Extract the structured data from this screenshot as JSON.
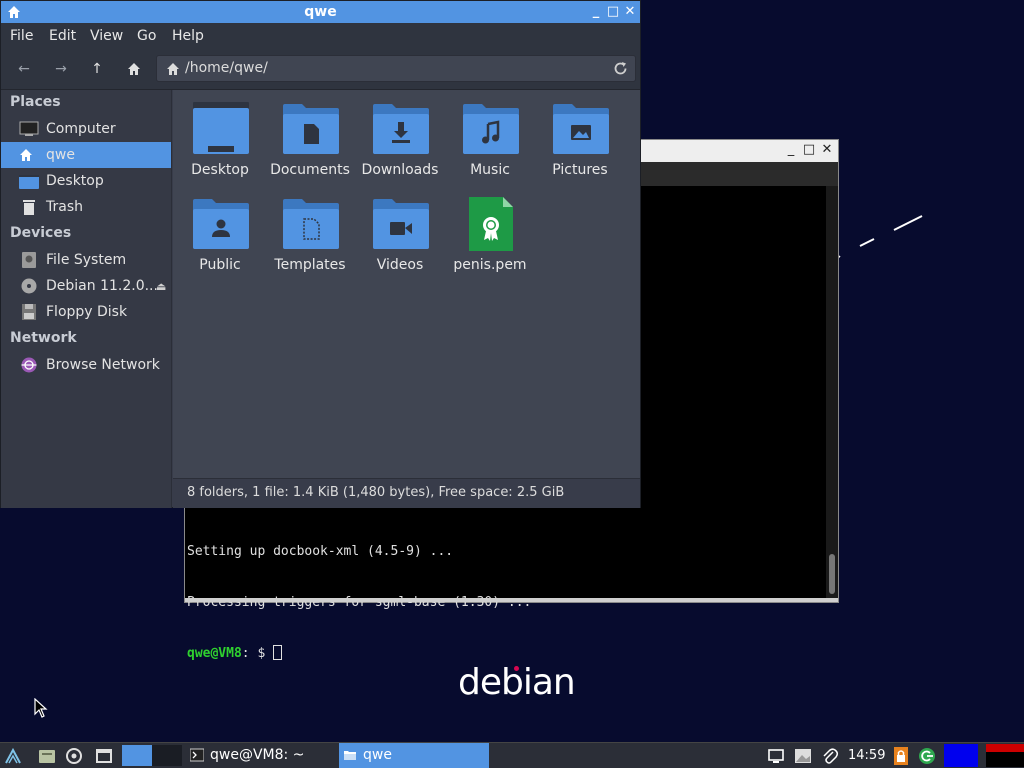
{
  "desktop": {
    "logo_text": "debian"
  },
  "terminal": {
    "lines": [
      "Setting up docbook-xml (4.5-9) ...",
      "Processing triggers for sgml-base (1.30) ..."
    ],
    "prompt_user": "qwe@VM8",
    "prompt_path": ": $ "
  },
  "file_manager": {
    "title": "qwe",
    "menu": [
      "File",
      "Edit",
      "View",
      "Go",
      "Help"
    ],
    "location": "/home/qwe/",
    "sidebar": {
      "places_header": "Places",
      "places": [
        "Computer",
        "qwe",
        "Desktop",
        "Trash"
      ],
      "devices_header": "Devices",
      "devices": [
        "File System",
        "Debian 11.2.0...",
        "Floppy Disk"
      ],
      "network_header": "Network",
      "network": [
        "Browse Network"
      ]
    },
    "files": [
      "Desktop",
      "Documents",
      "Downloads",
      "Music",
      "Pictures",
      "Public",
      "Templates",
      "Videos",
      "penis.pem"
    ],
    "status": "8 folders, 1 file: 1.4 KiB (1,480 bytes), Free space: 2.5 GiB",
    "colors": {
      "accent": "#5294e2",
      "folder": "#5294e2",
      "folder_dark": "#3c78c0",
      "cert_file": "#1e9a46"
    }
  },
  "taskbar": {
    "tasks": [
      {
        "label": "qwe@VM8: ~",
        "icon": "terminal-icon"
      },
      {
        "label": "qwe",
        "icon": "folder-icon"
      }
    ],
    "clock": "14:59"
  }
}
